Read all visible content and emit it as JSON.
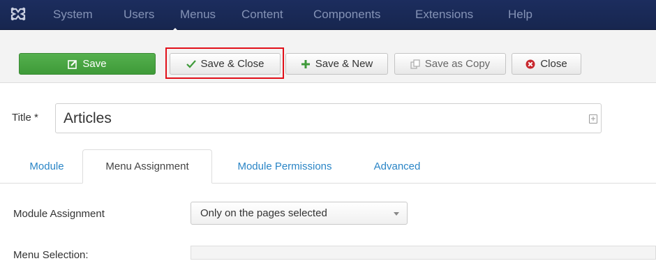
{
  "navbar": {
    "items": [
      "System",
      "Users",
      "Menus",
      "Content",
      "Components",
      "Extensions",
      "Help"
    ]
  },
  "toolbar": {
    "save_label": "Save",
    "save_close_label": "Save & Close",
    "save_new_label": "Save & New",
    "save_copy_label": "Save as Copy",
    "close_label": "Close"
  },
  "form": {
    "title_label": "Title *",
    "title_value": "Articles"
  },
  "tabs": [
    "Module",
    "Menu Assignment",
    "Module Permissions",
    "Advanced"
  ],
  "active_tab": "Menu Assignment",
  "module_assignment": {
    "label": "Module Assignment",
    "selected": "Only on the pages selected"
  },
  "next_field_label": "Menu Selection:",
  "colors": {
    "navbar": "#1c2d5e",
    "save_green": "#46a340",
    "highlight_red": "#e1101a",
    "link_blue": "#2a85c6"
  }
}
